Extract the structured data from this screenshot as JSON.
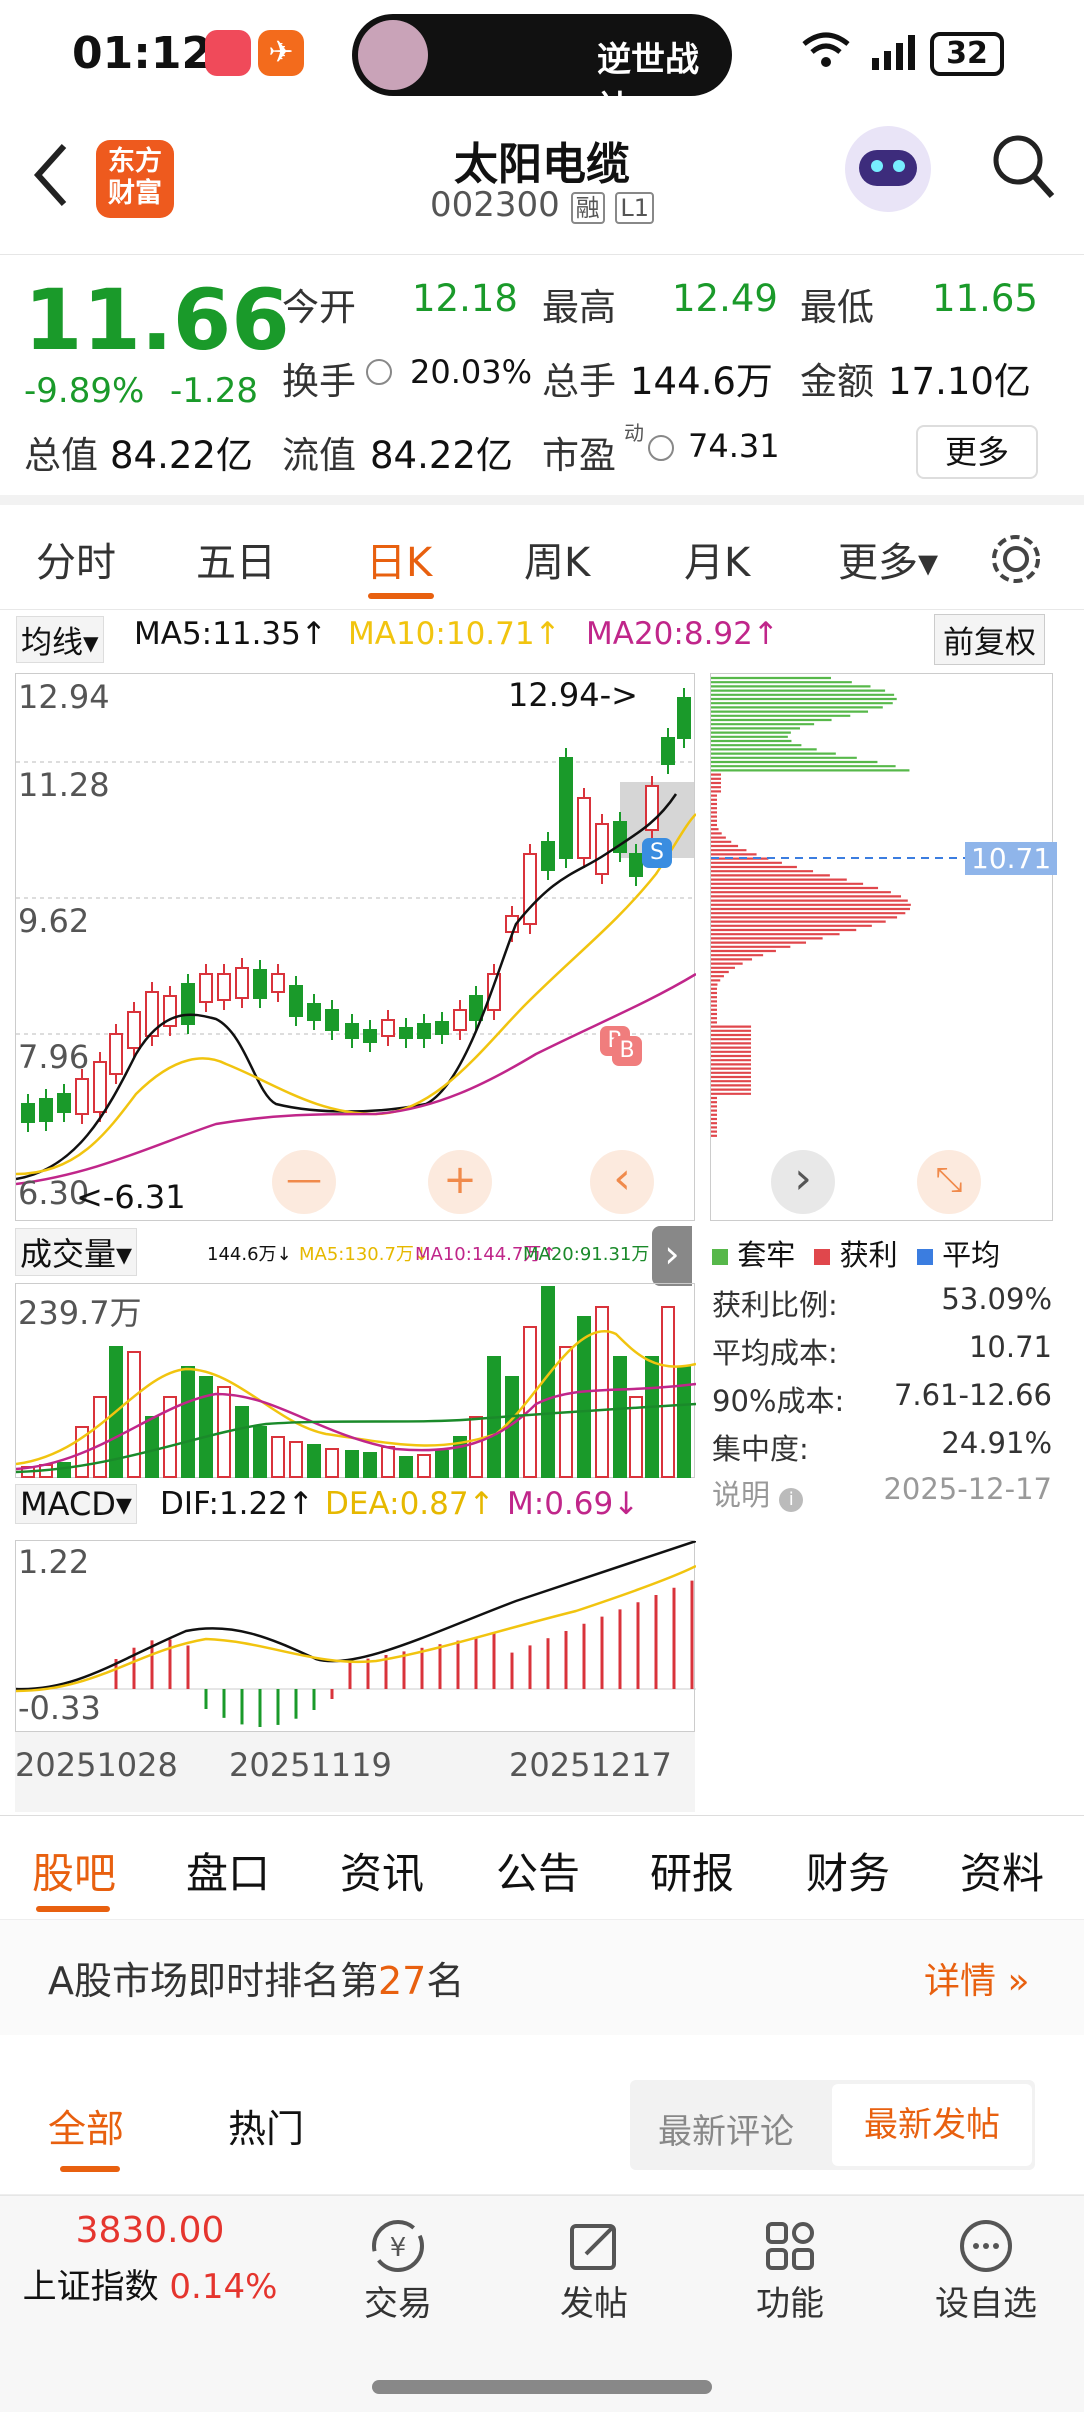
{
  "status": {
    "time": "01:12",
    "app_label": "App\nGallery",
    "music_text": "逆世战神",
    "battery": "32"
  },
  "header": {
    "back": "<",
    "logo_line1": "东方",
    "logo_line2": "财富",
    "stock_name": "太阳电缆",
    "stock_code": "002300",
    "tag_rong": "融",
    "tag_level": "L1"
  },
  "quote": {
    "price": "11.66",
    "change_pct": "-9.89%",
    "change": "-1.28",
    "open_label": "今开",
    "open": "12.18",
    "high_label": "最高",
    "high": "12.49",
    "low_label": "最低",
    "low": "11.65",
    "turnover_label": "换手",
    "turnover": "20.03%",
    "volume_label": "总手",
    "volume": "144.6万",
    "amount_label": "金额",
    "amount": "17.10亿",
    "mcap_label": "总值",
    "mcap": "84.22亿",
    "float_label": "流值",
    "float": "84.22亿",
    "pe_label": "市盈",
    "pe_sup": "动",
    "pe": "74.31",
    "more": "更多"
  },
  "tabs": [
    "分时",
    "五日",
    "日K",
    "周K",
    "月K",
    "更多▾"
  ],
  "ma": {
    "selector": "均线▾",
    "ma5": "MA5:11.35↑",
    "ma10": "MA10:10.71↑",
    "ma20": "MA20:8.92↑",
    "adjust": "前复权"
  },
  "kline": {
    "y_labels": [
      "12.94",
      "11.28",
      "9.62",
      "7.96",
      "6.30"
    ],
    "max_note": "12.94->",
    "min_note": "<-6.31",
    "s_marker": "S",
    "b_marker": "B",
    "minus": "—",
    "plus": "+",
    "prev": "‹",
    "next": "›",
    "expand": "⤡"
  },
  "chip": {
    "avg_label": "10.71",
    "legend": [
      "套牢",
      "获利",
      "平均"
    ],
    "colors": {
      "trapped": "#57b84a",
      "profit": "#e0474c",
      "avg": "#3b7de0"
    },
    "rows": [
      {
        "k": "获利比例:",
        "v": "53.09%"
      },
      {
        "k": "平均成本:",
        "v": "10.71"
      },
      {
        "k": "90%成本:",
        "v": "7.61-12.66"
      },
      {
        "k": "集中度:",
        "v": "24.91%"
      }
    ],
    "note_label": "说明",
    "date": "2025-12-17"
  },
  "volume": {
    "selector": "成交量▾",
    "vol": "144.6万↓",
    "ma5": "MA5:130.7万↓",
    "ma10": "MA10:144.7万↑",
    "ma20": "MA20:91.31万↑",
    "ymax": "239.7万"
  },
  "macd": {
    "selector": "MACD▾",
    "dif": "DIF:1.22↑",
    "dea": "DEA:0.87↑",
    "m": "M:0.69↓",
    "ymax": "1.22",
    "ymin": "-0.33"
  },
  "dates": [
    "20251028",
    "20251119",
    "20251217"
  ],
  "subtabs": [
    "股吧",
    "盘口",
    "资讯",
    "公告",
    "研报",
    "财务",
    "资料"
  ],
  "rank": {
    "text_pre": "A股市场即时排名第",
    "rank": "27",
    "text_post": "名",
    "detail": "详情 »"
  },
  "posttabs": {
    "all": "全部",
    "hot": "热门",
    "latest_comment": "最新评论",
    "latest_post": "最新发帖"
  },
  "bottom": {
    "index_value": "3830.00",
    "index_name": "上证指数",
    "index_pct": "0.14%",
    "trade": "交易",
    "post": "发帖",
    "func": "功能",
    "watch": "设自选"
  }
}
